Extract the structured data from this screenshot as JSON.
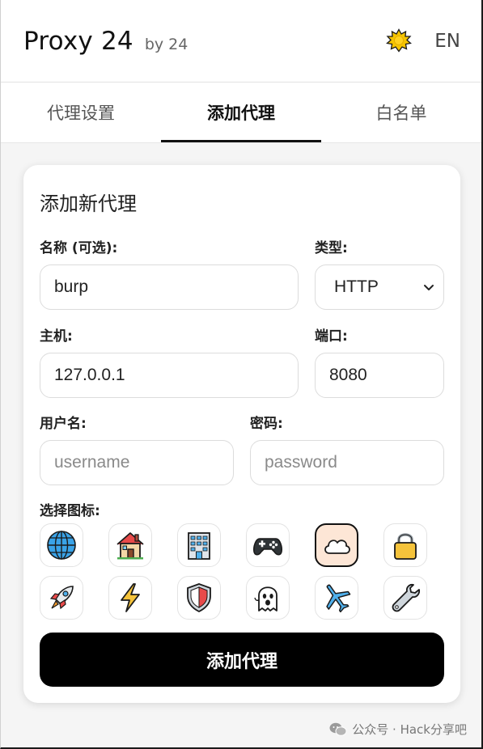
{
  "header": {
    "title": "Proxy 24",
    "by": "by 24",
    "theme_icon": "sun-icon",
    "lang": "EN"
  },
  "tabs": [
    {
      "label": "代理设置",
      "active": false
    },
    {
      "label": "添加代理",
      "active": true
    },
    {
      "label": "白名单",
      "active": false
    }
  ],
  "form": {
    "title": "添加新代理",
    "name_label": "名称 (可选):",
    "name_value": "burp",
    "type_label": "类型:",
    "type_value": "HTTP",
    "host_label": "主机:",
    "host_value": "127.0.0.1",
    "port_label": "端口:",
    "port_value": "8080",
    "username_label": "用户名:",
    "username_placeholder": "username",
    "password_label": "密码:",
    "password_placeholder": "password",
    "icon_label": "选择图标:",
    "icons": [
      "globe-icon",
      "house-icon",
      "office-building-icon",
      "game-controller-icon",
      "cloud-icon",
      "lock-icon",
      "rocket-icon",
      "lightning-icon",
      "shield-icon",
      "ghost-icon",
      "airplane-icon",
      "wrench-icon"
    ],
    "selected_icon": "cloud-icon",
    "submit_label": "添加代理"
  },
  "watermark": {
    "text": "公众号 · Hack分享吧"
  },
  "colors": {
    "accent": "#000000",
    "selected_icon_bg": "#fde6d6"
  }
}
